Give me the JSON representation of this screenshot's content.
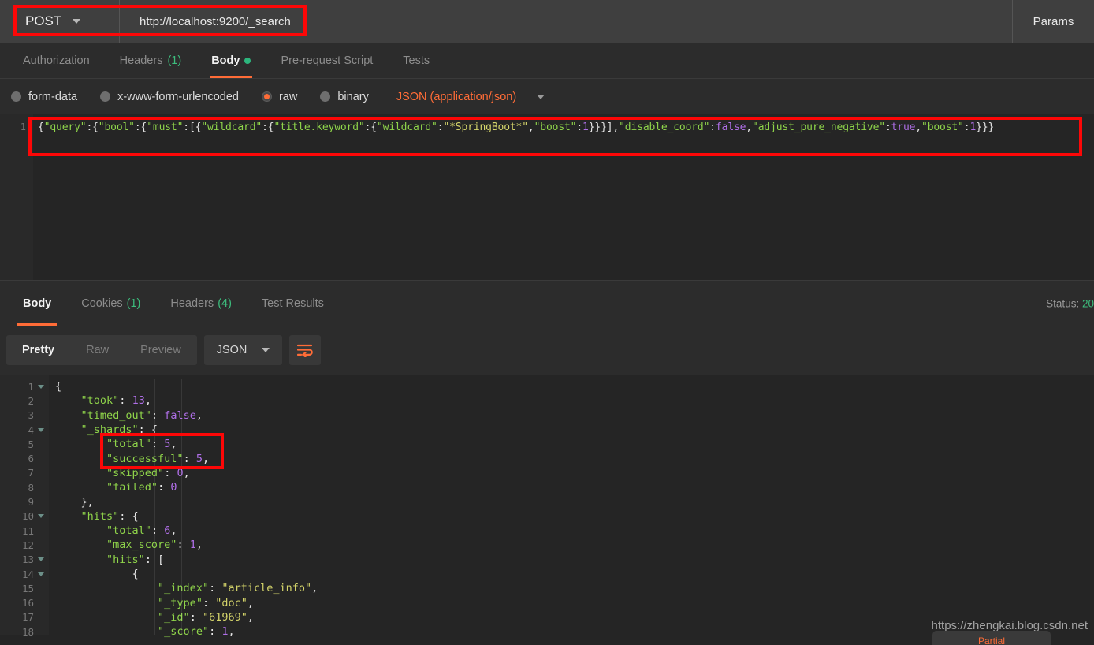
{
  "request_bar": {
    "method": "POST",
    "url": "http://localhost:9200/_search",
    "params_label": "Params"
  },
  "request_tabs": [
    {
      "label": "Authorization",
      "count": "",
      "active": false,
      "dot": false
    },
    {
      "label": "Headers",
      "count": "(1)",
      "active": false,
      "dot": false
    },
    {
      "label": "Body",
      "count": "",
      "active": true,
      "dot": true
    },
    {
      "label": "Pre-request Script",
      "count": "",
      "active": false,
      "dot": false
    },
    {
      "label": "Tests",
      "count": "",
      "active": false,
      "dot": false
    }
  ],
  "body_type": {
    "options": [
      {
        "label": "form-data",
        "selected": false
      },
      {
        "label": "x-www-form-urlencoded",
        "selected": false
      },
      {
        "label": "raw",
        "selected": true
      },
      {
        "label": "binary",
        "selected": false
      }
    ],
    "content_type": "JSON (application/json)"
  },
  "request_body": {
    "line_number": "1",
    "tokens": [
      {
        "t": "{",
        "c": "p"
      },
      {
        "t": "\"query\"",
        "c": "k"
      },
      {
        "t": ":{",
        "c": "p"
      },
      {
        "t": "\"bool\"",
        "c": "k"
      },
      {
        "t": ":{",
        "c": "p"
      },
      {
        "t": "\"must\"",
        "c": "k"
      },
      {
        "t": ":[{",
        "c": "p"
      },
      {
        "t": "\"wildcard\"",
        "c": "k"
      },
      {
        "t": ":{",
        "c": "p"
      },
      {
        "t": "\"title.keyword\"",
        "c": "k"
      },
      {
        "t": ":{",
        "c": "p"
      },
      {
        "t": "\"wildcard\"",
        "c": "k"
      },
      {
        "t": ":",
        "c": "p"
      },
      {
        "t": "\"*SpringBoot*\"",
        "c": "s"
      },
      {
        "t": ",",
        "c": "p"
      },
      {
        "t": "\"boost\"",
        "c": "k"
      },
      {
        "t": ":",
        "c": "p"
      },
      {
        "t": "1",
        "c": "n"
      },
      {
        "t": "}}}],",
        "c": "p"
      },
      {
        "t": "\"disable_coord\"",
        "c": "k"
      },
      {
        "t": ":",
        "c": "p"
      },
      {
        "t": "false",
        "c": "b"
      },
      {
        "t": ",",
        "c": "p"
      },
      {
        "t": "\"adjust_pure_negative\"",
        "c": "k"
      },
      {
        "t": ":",
        "c": "p"
      },
      {
        "t": "true",
        "c": "b"
      },
      {
        "t": ",",
        "c": "p"
      },
      {
        "t": "\"boost\"",
        "c": "k"
      },
      {
        "t": ":",
        "c": "p"
      },
      {
        "t": "1",
        "c": "n"
      },
      {
        "t": "}}}",
        "c": "p"
      }
    ],
    "raw_text": "{\"query\":{\"bool\":{\"must\":[{\"wildcard\":{\"title.keyword\":{\"wildcard\":\"*SpringBoot*\",\"boost\":1}}}],\"disable_coord\":false,\"adjust_pure_negative\":true,\"boost\":1}}}"
  },
  "response_tabs": [
    {
      "label": "Body",
      "count": "",
      "active": true
    },
    {
      "label": "Cookies",
      "count": "(1)",
      "active": false
    },
    {
      "label": "Headers",
      "count": "(4)",
      "active": false
    },
    {
      "label": "Test Results",
      "count": "",
      "active": false
    }
  ],
  "response_status": {
    "label": "Status:",
    "code": "20"
  },
  "response_toolbar": {
    "view_modes": [
      {
        "label": "Pretty",
        "active": true
      },
      {
        "label": "Raw",
        "active": false
      },
      {
        "label": "Preview",
        "active": false
      }
    ],
    "format": "JSON",
    "wrap_icon": "word-wrap-icon"
  },
  "response_body": {
    "lines": [
      {
        "num": "1",
        "fold": true,
        "indent": 0,
        "tokens": [
          {
            "t": "{",
            "c": "p"
          }
        ]
      },
      {
        "num": "2",
        "fold": false,
        "indent": 1,
        "tokens": [
          {
            "t": "    ",
            "c": "p"
          },
          {
            "t": "\"took\"",
            "c": "k"
          },
          {
            "t": ": ",
            "c": "p"
          },
          {
            "t": "13",
            "c": "n"
          },
          {
            "t": ",",
            "c": "p"
          }
        ]
      },
      {
        "num": "3",
        "fold": false,
        "indent": 1,
        "tokens": [
          {
            "t": "    ",
            "c": "p"
          },
          {
            "t": "\"timed_out\"",
            "c": "k"
          },
          {
            "t": ": ",
            "c": "p"
          },
          {
            "t": "false",
            "c": "b"
          },
          {
            "t": ",",
            "c": "p"
          }
        ]
      },
      {
        "num": "4",
        "fold": true,
        "indent": 1,
        "tokens": [
          {
            "t": "    ",
            "c": "p"
          },
          {
            "t": "\"_shards\"",
            "c": "k"
          },
          {
            "t": ": {",
            "c": "p"
          }
        ]
      },
      {
        "num": "5",
        "fold": false,
        "indent": 2,
        "tokens": [
          {
            "t": "        ",
            "c": "p"
          },
          {
            "t": "\"total\"",
            "c": "k"
          },
          {
            "t": ": ",
            "c": "p"
          },
          {
            "t": "5",
            "c": "n"
          },
          {
            "t": ",",
            "c": "p"
          }
        ]
      },
      {
        "num": "6",
        "fold": false,
        "indent": 2,
        "tokens": [
          {
            "t": "        ",
            "c": "p"
          },
          {
            "t": "\"successful\"",
            "c": "k"
          },
          {
            "t": ": ",
            "c": "p"
          },
          {
            "t": "5",
            "c": "n"
          },
          {
            "t": ",",
            "c": "p"
          }
        ]
      },
      {
        "num": "7",
        "fold": false,
        "indent": 2,
        "tokens": [
          {
            "t": "        ",
            "c": "p"
          },
          {
            "t": "\"skipped\"",
            "c": "k"
          },
          {
            "t": ": ",
            "c": "p"
          },
          {
            "t": "0",
            "c": "n"
          },
          {
            "t": ",",
            "c": "p"
          }
        ]
      },
      {
        "num": "8",
        "fold": false,
        "indent": 2,
        "tokens": [
          {
            "t": "        ",
            "c": "p"
          },
          {
            "t": "\"failed\"",
            "c": "k"
          },
          {
            "t": ": ",
            "c": "p"
          },
          {
            "t": "0",
            "c": "n"
          }
        ]
      },
      {
        "num": "9",
        "fold": false,
        "indent": 1,
        "tokens": [
          {
            "t": "    ",
            "c": "p"
          },
          {
            "t": "},",
            "c": "p"
          }
        ]
      },
      {
        "num": "10",
        "fold": true,
        "indent": 1,
        "tokens": [
          {
            "t": "    ",
            "c": "p"
          },
          {
            "t": "\"hits\"",
            "c": "k"
          },
          {
            "t": ": {",
            "c": "p"
          }
        ]
      },
      {
        "num": "11",
        "fold": false,
        "indent": 2,
        "tokens": [
          {
            "t": "        ",
            "c": "p"
          },
          {
            "t": "\"total\"",
            "c": "k"
          },
          {
            "t": ": ",
            "c": "p"
          },
          {
            "t": "6",
            "c": "n"
          },
          {
            "t": ",",
            "c": "p"
          }
        ]
      },
      {
        "num": "12",
        "fold": false,
        "indent": 2,
        "tokens": [
          {
            "t": "        ",
            "c": "p"
          },
          {
            "t": "\"max_score\"",
            "c": "k"
          },
          {
            "t": ": ",
            "c": "p"
          },
          {
            "t": "1",
            "c": "n"
          },
          {
            "t": ",",
            "c": "p"
          }
        ]
      },
      {
        "num": "13",
        "fold": true,
        "indent": 2,
        "tokens": [
          {
            "t": "        ",
            "c": "p"
          },
          {
            "t": "\"hits\"",
            "c": "k"
          },
          {
            "t": ": [",
            "c": "p"
          }
        ]
      },
      {
        "num": "14",
        "fold": true,
        "indent": 3,
        "tokens": [
          {
            "t": "            ",
            "c": "p"
          },
          {
            "t": "{",
            "c": "p"
          }
        ]
      },
      {
        "num": "15",
        "fold": false,
        "indent": 4,
        "tokens": [
          {
            "t": "                ",
            "c": "p"
          },
          {
            "t": "\"_index\"",
            "c": "k"
          },
          {
            "t": ": ",
            "c": "p"
          },
          {
            "t": "\"article_info\"",
            "c": "s"
          },
          {
            "t": ",",
            "c": "p"
          }
        ]
      },
      {
        "num": "16",
        "fold": false,
        "indent": 4,
        "tokens": [
          {
            "t": "                ",
            "c": "p"
          },
          {
            "t": "\"_type\"",
            "c": "k"
          },
          {
            "t": ": ",
            "c": "p"
          },
          {
            "t": "\"doc\"",
            "c": "s"
          },
          {
            "t": ",",
            "c": "p"
          }
        ]
      },
      {
        "num": "17",
        "fold": false,
        "indent": 4,
        "tokens": [
          {
            "t": "                ",
            "c": "p"
          },
          {
            "t": "\"_id\"",
            "c": "k"
          },
          {
            "t": ": ",
            "c": "p"
          },
          {
            "t": "\"61969\"",
            "c": "s"
          },
          {
            "t": ",",
            "c": "p"
          }
        ]
      },
      {
        "num": "18",
        "fold": false,
        "indent": 4,
        "tokens": [
          {
            "t": "                ",
            "c": "p"
          },
          {
            "t": "\"_score\"",
            "c": "k"
          },
          {
            "t": ": ",
            "c": "p"
          },
          {
            "t": "1",
            "c": "n"
          },
          {
            "t": ",",
            "c": "p"
          }
        ]
      }
    ]
  },
  "watermark": {
    "url": "https://zhengkai.blog.csdn.net",
    "pill_text": "Partial"
  },
  "colors": {
    "accent": "#ff6c37",
    "annotation": "#fd0707",
    "success": "#3dbd7d",
    "key": "#8fd44a",
    "string": "#d4d46a",
    "number": "#b06fe8"
  }
}
